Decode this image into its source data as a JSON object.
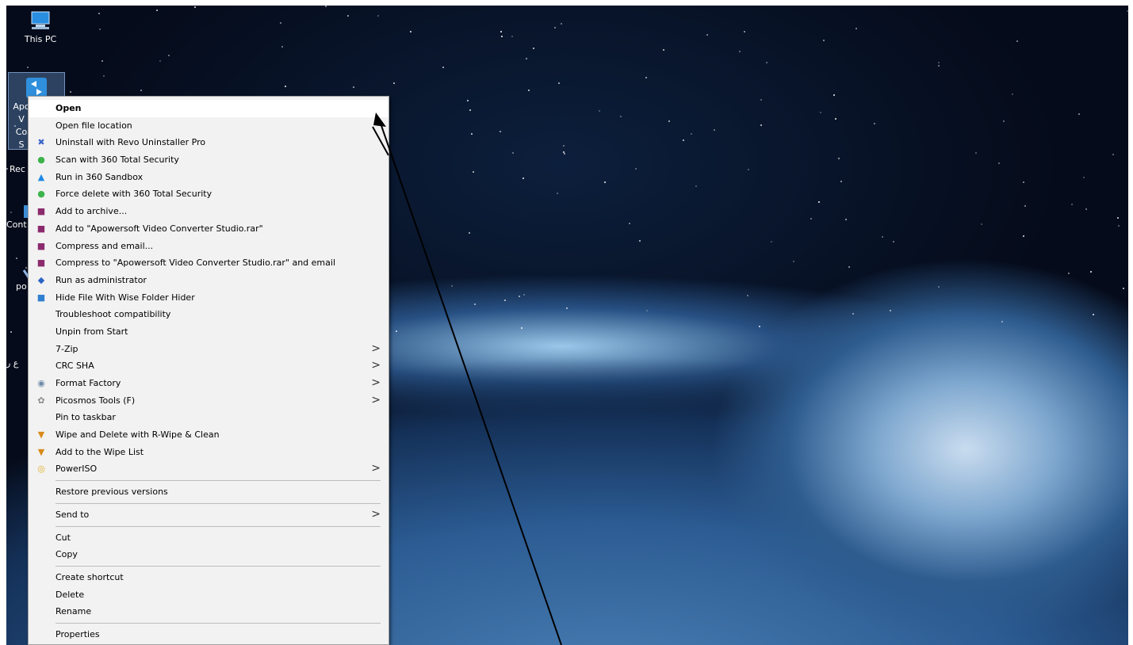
{
  "desktop_icons": [
    {
      "label": "This PC",
      "icon": "computer-icon"
    },
    {
      "label": "Apo\nV\nCo\nS",
      "icon": "apowersoft-icon"
    },
    {
      "label": "Rec",
      "icon": "recycle-bin-icon"
    },
    {
      "label": "Cont",
      "icon": "control-panel-icon"
    },
    {
      "label": "po",
      "icon": "shortcut-icon"
    },
    {
      "label": "ع ر",
      "icon": "folder-icon"
    }
  ],
  "context_menu": {
    "items": [
      {
        "label": "Open",
        "icon": "",
        "bold": true
      },
      {
        "label": "Open file location",
        "icon": ""
      },
      {
        "label": "Uninstall with Revo Uninstaller Pro",
        "icon": "revo-uninstaller-icon",
        "glyph": "✖",
        "color": "#3a64c8"
      },
      {
        "label": "Scan with 360 Total Security",
        "icon": "360-security-icon",
        "glyph": "●",
        "color": "#3db34a"
      },
      {
        "label": "Run in 360 Sandbox",
        "icon": "sandbox-icon",
        "glyph": "▲",
        "color": "#1e88e5"
      },
      {
        "label": "Force delete with 360 Total Security",
        "icon": "360-security-icon",
        "glyph": "●",
        "color": "#3db34a"
      },
      {
        "label": "Add to archive...",
        "icon": "winrar-icon",
        "glyph": "■",
        "color": "#8b2b6e"
      },
      {
        "label": "Add to \"Apowersoft Video Converter Studio.rar\"",
        "icon": "winrar-icon",
        "glyph": "■",
        "color": "#8b2b6e"
      },
      {
        "label": "Compress and email...",
        "icon": "winrar-icon",
        "glyph": "■",
        "color": "#8b2b6e"
      },
      {
        "label": "Compress to \"Apowersoft Video Converter Studio.rar\" and email",
        "icon": "winrar-icon",
        "glyph": "■",
        "color": "#8b2b6e"
      },
      {
        "label": "Run as administrator",
        "icon": "uac-shield-icon",
        "glyph": "◆",
        "color": "#2a63c4"
      },
      {
        "label": "Hide File With Wise Folder Hider",
        "icon": "wise-folder-hider-icon",
        "glyph": "■",
        "color": "#2f7fd1"
      },
      {
        "label": "Troubleshoot compatibility",
        "icon": ""
      },
      {
        "label": "Unpin from Start",
        "icon": ""
      },
      {
        "label": "7-Zip",
        "icon": "",
        "submenu": true
      },
      {
        "label": "CRC SHA",
        "icon": "",
        "submenu": true
      },
      {
        "label": "Format Factory",
        "icon": "format-factory-icon",
        "glyph": "◉",
        "color": "#6d8aa8",
        "submenu": true
      },
      {
        "label": "Picosmos Tools (F)",
        "icon": "picosmos-icon",
        "glyph": "✿",
        "color": "#8a8a8a",
        "submenu": true
      },
      {
        "label": "Pin to taskbar",
        "icon": ""
      },
      {
        "label": "Wipe and Delete with R-Wipe & Clean",
        "icon": "r-wipe-icon",
        "glyph": "▼",
        "color": "#d98a1a"
      },
      {
        "label": "Add to the Wipe List",
        "icon": "r-wipe-icon",
        "glyph": "▼",
        "color": "#d98a1a"
      },
      {
        "label": "PowerISO",
        "icon": "poweriso-icon",
        "glyph": "◎",
        "color": "#e0b020",
        "submenu": true
      }
    ],
    "group2": [
      {
        "label": "Restore previous versions"
      }
    ],
    "group3": [
      {
        "label": "Send to",
        "submenu": true
      }
    ],
    "group4": [
      {
        "label": "Cut"
      },
      {
        "label": "Copy"
      }
    ],
    "group5": [
      {
        "label": "Create shortcut"
      },
      {
        "label": "Delete"
      },
      {
        "label": "Rename"
      }
    ],
    "group6": [
      {
        "label": "Properties"
      }
    ],
    "submenu_arrow": ">"
  }
}
